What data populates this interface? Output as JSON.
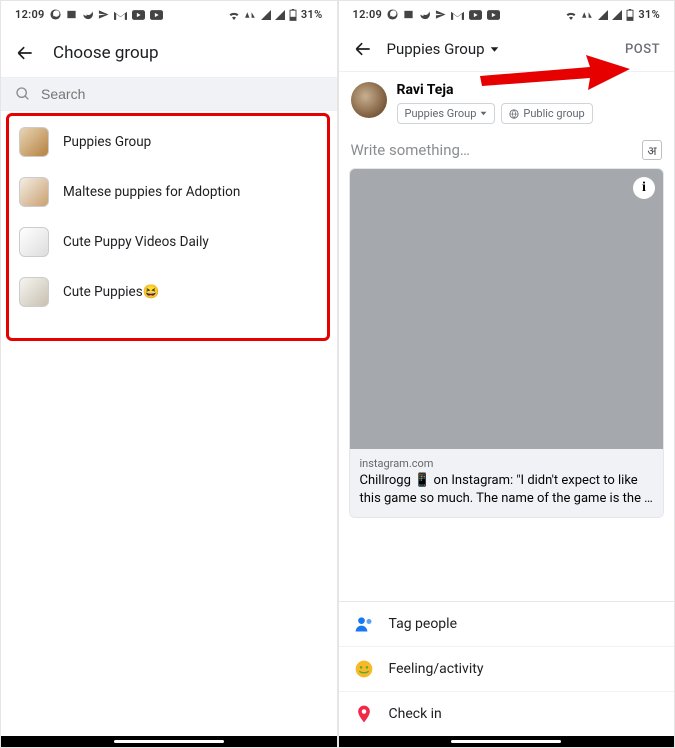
{
  "status": {
    "time": "12:09",
    "battery": "31%"
  },
  "left": {
    "title": "Choose group",
    "search_placeholder": "Search",
    "groups": [
      {
        "label": "Puppies Group"
      },
      {
        "label": "Maltese puppies for Adoption"
      },
      {
        "label": "Cute Puppy Videos Daily"
      },
      {
        "label": "Cute Puppies😆"
      }
    ]
  },
  "right": {
    "selected_group": "Puppies Group",
    "post_label": "POST",
    "author": "Ravi Teja",
    "chip_group": "Puppies Group",
    "chip_privacy": "Public group",
    "placeholder": "Write something…",
    "lang_char": "अ",
    "preview": {
      "source": "instagram.com",
      "text": "Chillrogg 📱 on Instagram: \"I didn't expect to like this game so much. The name of the game is the …"
    },
    "options": [
      {
        "label": "Tag people",
        "icon": "tag-people-icon"
      },
      {
        "label": "Feeling/activity",
        "icon": "feeling-icon"
      },
      {
        "label": "Check in",
        "icon": "checkin-icon"
      }
    ]
  }
}
